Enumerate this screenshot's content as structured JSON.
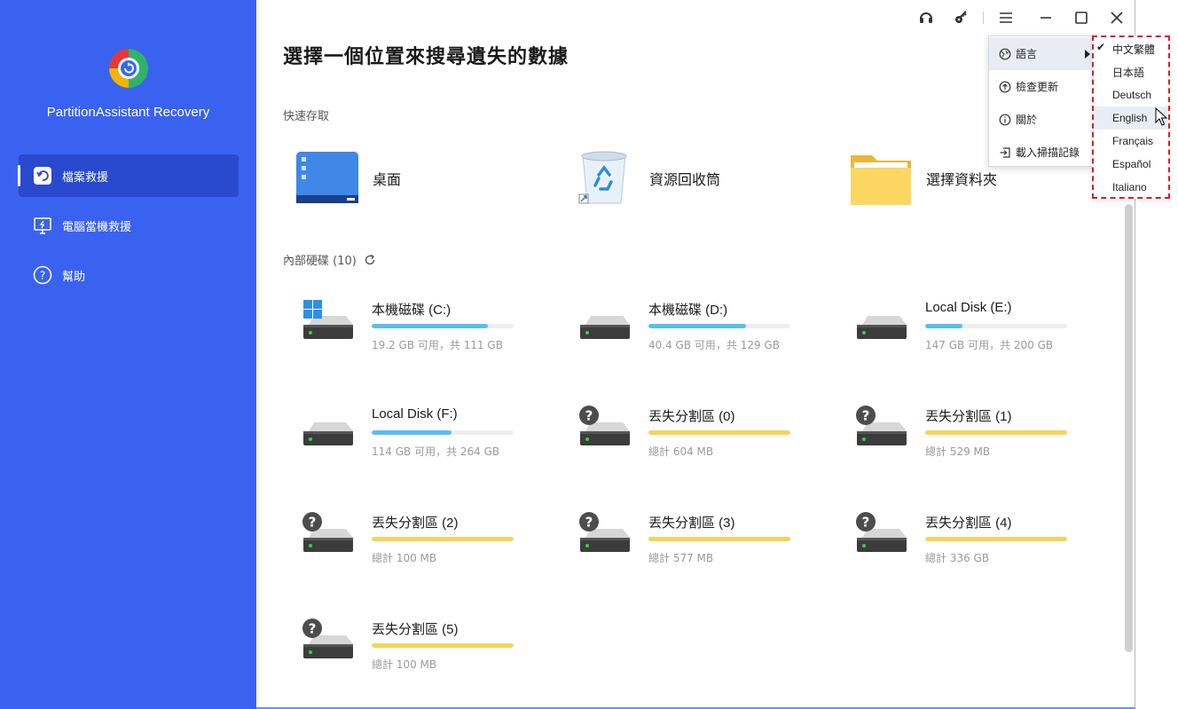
{
  "app": {
    "name": "PartitionAssistant Recovery"
  },
  "sidebar": {
    "items": [
      {
        "label": "檔案救援"
      },
      {
        "label": "電腦當機救援"
      },
      {
        "label": "幫助"
      }
    ]
  },
  "main": {
    "title": "選擇一個位置來搜尋遺失的數據",
    "quick_access_label": "快速存取",
    "quick_items": [
      {
        "label": "桌面"
      },
      {
        "label": "資源回收筒"
      },
      {
        "label": "選擇資料夾"
      }
    ],
    "disks_label": "內部硬碟 (10)",
    "disks": [
      {
        "name": "本機磁碟 (C:)",
        "size": "19.2 GB 可用，共 111 GB",
        "usage": 0.82,
        "bar_color": "#5bbcf2",
        "icon": "windows-drive-icon"
      },
      {
        "name": "本機磁碟 (D:)",
        "size": "40.4 GB 可用，共 129 GB",
        "usage": 0.69,
        "bar_color": "#5bbcf2",
        "icon": "drive-icon"
      },
      {
        "name": "Local Disk (E:)",
        "size": "147 GB 可用，共 200 GB",
        "usage": 0.26,
        "bar_color": "#5bbcf2",
        "icon": "drive-icon"
      },
      {
        "name": "Local Disk (F:)",
        "size": "114 GB 可用，共 264 GB",
        "usage": 0.56,
        "bar_color": "#5bbcf2",
        "icon": "drive-icon"
      },
      {
        "name": "丟失分割區 (0)",
        "size": "總計 604 MB",
        "usage": 1.0,
        "bar_color": "#f8d25c",
        "icon": "lost-partition-icon"
      },
      {
        "name": "丟失分割區 (1)",
        "size": "總計 529 MB",
        "usage": 1.0,
        "bar_color": "#f8d25c",
        "icon": "lost-partition-icon"
      },
      {
        "name": "丟失分割區 (2)",
        "size": "總計 100 MB",
        "usage": 1.0,
        "bar_color": "#f8d25c",
        "icon": "lost-partition-icon"
      },
      {
        "name": "丟失分割區 (3)",
        "size": "總計 577 MB",
        "usage": 1.0,
        "bar_color": "#f8d25c",
        "icon": "lost-partition-icon"
      },
      {
        "name": "丟失分割區 (4)",
        "size": "總計 336 GB",
        "usage": 1.0,
        "bar_color": "#f8d25c",
        "icon": "lost-partition-icon"
      },
      {
        "name": "丟失分割區 (5)",
        "size": "總計 100 MB",
        "usage": 1.0,
        "bar_color": "#f8d25c",
        "icon": "lost-partition-icon"
      }
    ]
  },
  "menu": {
    "items": [
      {
        "label": "語言"
      },
      {
        "label": "檢查更新"
      },
      {
        "label": "關於"
      },
      {
        "label": "載入掃描記錄"
      }
    ]
  },
  "language_menu": {
    "selected": "中文繁體",
    "hovered": "English",
    "items": [
      "中文繁體",
      "日本語",
      "Deutsch",
      "English",
      "Français",
      "Español",
      "Italiano"
    ]
  },
  "colors": {
    "sidebar": "#3a62f0",
    "sidebar_active": "#2949cf",
    "used_bar": "#5bbcf2",
    "lost_bar": "#f8d25c",
    "highlight_border": "#d3202a"
  }
}
